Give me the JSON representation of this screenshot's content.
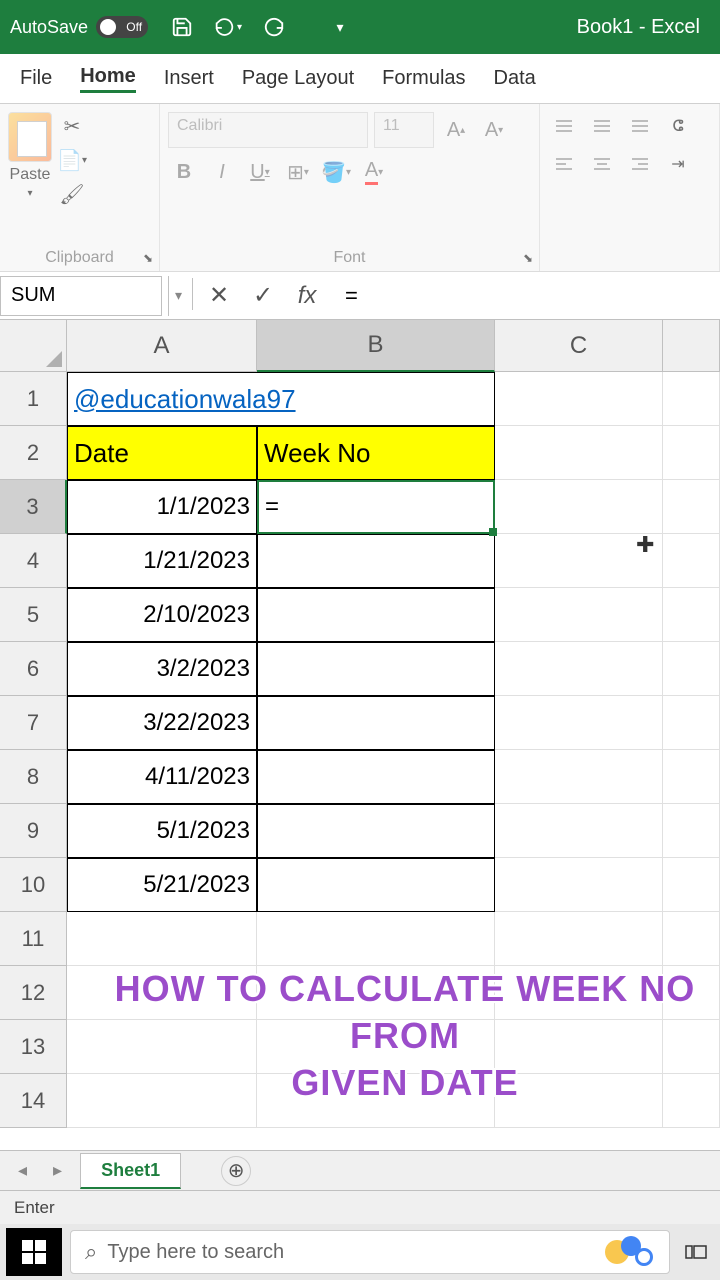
{
  "title_bar": {
    "autosave_label": "AutoSave",
    "autosave_state": "Off",
    "book_title": "Book1 - Excel"
  },
  "menu": {
    "file": "File",
    "home": "Home",
    "insert": "Insert",
    "page_layout": "Page Layout",
    "formulas": "Formulas",
    "data": "Data"
  },
  "ribbon": {
    "paste": "Paste",
    "clipboard": "Clipboard",
    "font_name": "Calibri",
    "font_size": "11",
    "font_label": "Font"
  },
  "formula_bar": {
    "name_box": "SUM",
    "formula": "="
  },
  "columns": {
    "a": "A",
    "b": "B",
    "c": "C"
  },
  "rows": [
    "1",
    "2",
    "3",
    "4",
    "5",
    "6",
    "7",
    "8",
    "9",
    "10",
    "11",
    "12",
    "13",
    "14"
  ],
  "cells": {
    "a1": "@educationwala97",
    "a2": "Date",
    "b2": "Week No",
    "a3": "1/1/2023",
    "a4": "1/21/2023",
    "a5": "2/10/2023",
    "a6": "3/2/2023",
    "a7": "3/22/2023",
    "a8": "4/11/2023",
    "a9": "5/1/2023",
    "a10": "5/21/2023",
    "b3": "="
  },
  "overlay": {
    "line1": "HOW TO CALCULATE WEEK NO FROM",
    "line2": "GIVEN DATE"
  },
  "sheet": {
    "name": "Sheet1"
  },
  "status": {
    "mode": "Enter"
  },
  "taskbar": {
    "search_placeholder": "Type here to search"
  }
}
